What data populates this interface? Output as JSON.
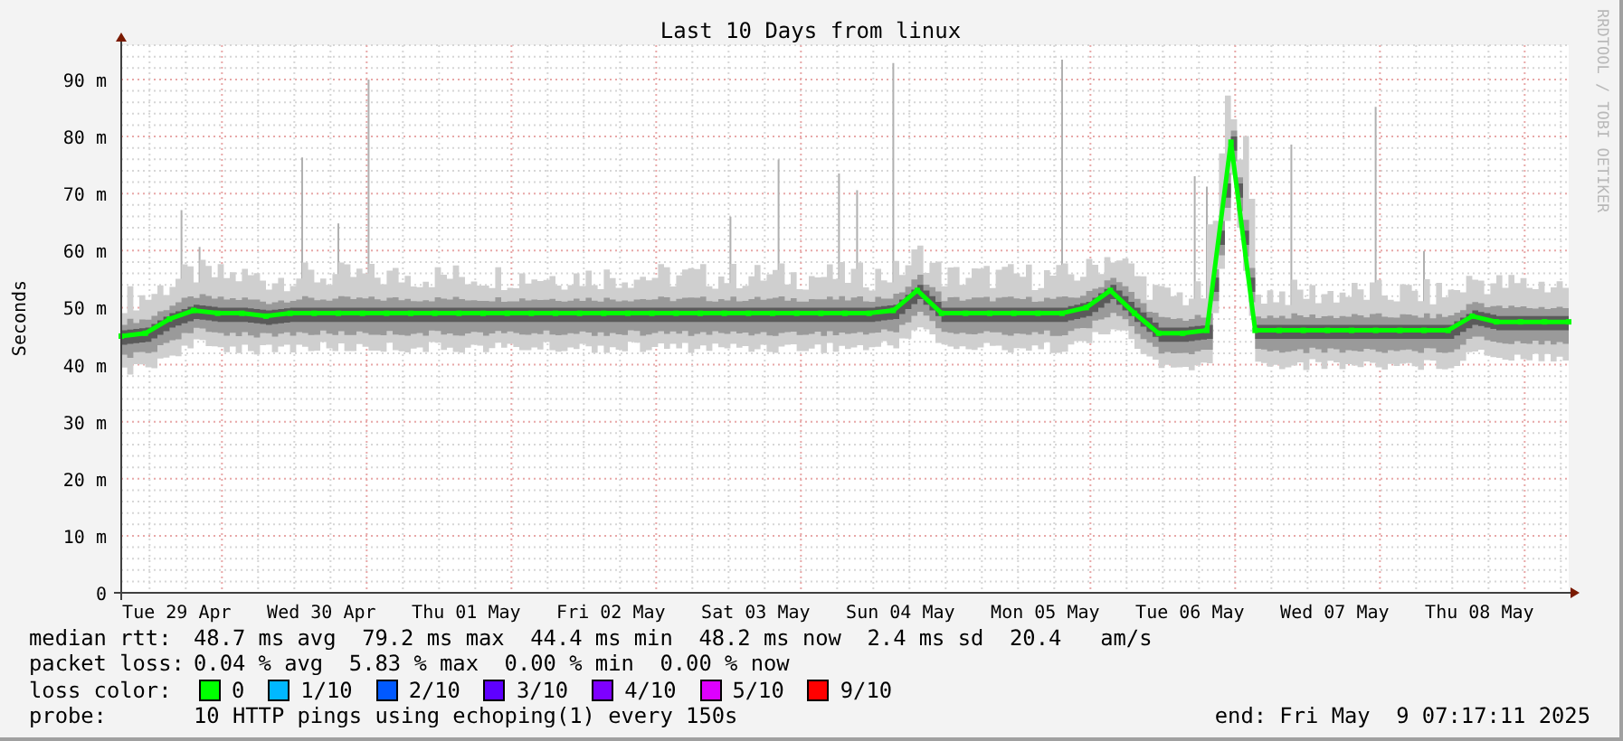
{
  "title": "Last 10 Days from linux",
  "credit": "RRDTOOL / TOBI OETIKER",
  "chart_data": {
    "type": "line",
    "ylabel": "Seconds",
    "categories": [
      null,
      null,
      "Tue 29 Apr",
      null,
      null,
      null,
      null,
      null,
      "Wed 30 Apr",
      null,
      null,
      null,
      null,
      null,
      "Thu 01 May",
      null,
      null,
      null,
      null,
      null,
      "Fri 02 May",
      null,
      null,
      null,
      null,
      null,
      "Sat 03 May",
      null,
      null,
      null,
      null,
      null,
      "Sun 04 May",
      null,
      null,
      null,
      null,
      null,
      "Mon 05 May",
      null,
      null,
      null,
      null,
      null,
      "Tue 06 May",
      null,
      null,
      null,
      null,
      null,
      "Wed 07 May",
      null,
      null,
      null,
      null,
      null,
      "Thu 08 May",
      null,
      null,
      null,
      null
    ],
    "series": [
      {
        "color": "#00ff00",
        "marker": "square",
        "values": [
          45,
          45.5,
          48,
          49.5,
          49,
          49,
          48.5,
          49,
          49,
          49,
          49,
          49,
          49,
          49,
          49,
          49,
          49,
          49,
          49,
          49,
          49,
          49,
          49,
          49,
          49,
          49,
          49,
          49,
          49,
          49,
          49,
          49,
          49.5,
          53,
          49,
          49,
          49,
          49,
          49,
          49,
          50,
          53,
          49,
          45.5,
          45.5,
          46,
          79,
          46,
          46,
          46,
          46,
          46,
          46,
          46,
          46,
          46,
          48.5,
          47.5,
          47.5,
          47.5,
          47.5
        ]
      }
    ],
    "ylim": [
      0,
      96
    ],
    "grid": true,
    "yticks": [
      {
        "value": 0,
        "label": "0"
      },
      {
        "value": 10,
        "label": "10 m"
      },
      {
        "value": 20,
        "label": "20 m"
      },
      {
        "value": 30,
        "label": "30 m"
      },
      {
        "value": 40,
        "label": "40 m"
      },
      {
        "value": 50,
        "label": "50 m"
      },
      {
        "value": 60,
        "label": "60 m"
      },
      {
        "value": 70,
        "label": "70 m"
      },
      {
        "value": 80,
        "label": "80 m"
      },
      {
        "value": 90,
        "label": "90 m"
      }
    ]
  },
  "stats": [
    {
      "label": "median rtt:",
      "text": "48.7 ms avg  79.2 ms max  44.4 ms min  48.2 ms now  2.4 ms sd  20.4   am/s"
    },
    {
      "label": "packet loss:",
      "text": "0.04 % avg  5.83 % max  0.00 % min  0.00 % now"
    }
  ],
  "loss_colors": {
    "label": "loss color:",
    "items": [
      {
        "label": "0",
        "color": "#00ff00"
      },
      {
        "label": "1/10",
        "color": "#00b8ff"
      },
      {
        "label": "2/10",
        "color": "#0059ff"
      },
      {
        "label": "3/10",
        "color": "#5e00ff"
      },
      {
        "label": "4/10",
        "color": "#7e00ff"
      },
      {
        "label": "5/10",
        "color": "#dd00ff"
      },
      {
        "label": "9/10",
        "color": "#ff0000"
      }
    ]
  },
  "probe": {
    "label": "probe:",
    "text": "10 HTTP pings using echoping(1) every 150s"
  },
  "end": "end: Fri May  9 07:17:11 2025"
}
